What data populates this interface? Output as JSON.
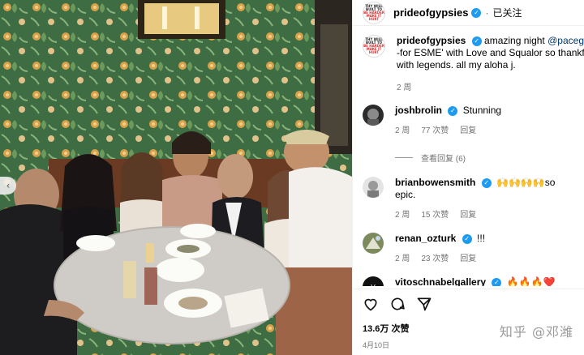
{
  "post": {
    "username": "prideofgypsies",
    "follow_status": "已关注",
    "caption_mention": "@pacegallery",
    "caption_text": "amazing night",
    "caption_rest_line2": "-for ESME' with Love and Squalor so thankful t",
    "caption_rest_line3": "with legends. all my aloha j.",
    "caption_time": "2 周",
    "logo_lines": [
      "THY WILL",
      "BUILT TO",
      "BE HARDER",
      "MAKE IT",
      "HURT"
    ]
  },
  "comments": [
    {
      "user": "joshbrolin",
      "verified": true,
      "text": "Stunning",
      "time": "2 周",
      "likes": "77 次赞",
      "reply": "回复",
      "view_replies": "查看回复 (6)"
    },
    {
      "user": "brianbowensmith",
      "verified": true,
      "text": "🙌🙌🙌🙌so epic.",
      "time": "2 周",
      "likes": "15 次赞",
      "reply": "回复"
    },
    {
      "user": "renan_ozturk",
      "verified": true,
      "text": "!!!",
      "time": "2 周",
      "likes": "23 次赞",
      "reply": "回复"
    },
    {
      "user": "vitoschnabelgallery",
      "verified": true,
      "text": "🔥🔥🔥❤️"
    }
  ],
  "footer": {
    "likes": "13.6万 次赞",
    "date": "4月10日"
  },
  "watermark": "知乎 @邓潍",
  "icons": {
    "like": "heart-icon",
    "comment": "comment-icon",
    "share": "share-icon",
    "prev": "chevron-left-icon"
  },
  "colors": {
    "verified": "#1d9bf0",
    "mention": "#00376b",
    "wallpaper": "#3f6b3f"
  }
}
